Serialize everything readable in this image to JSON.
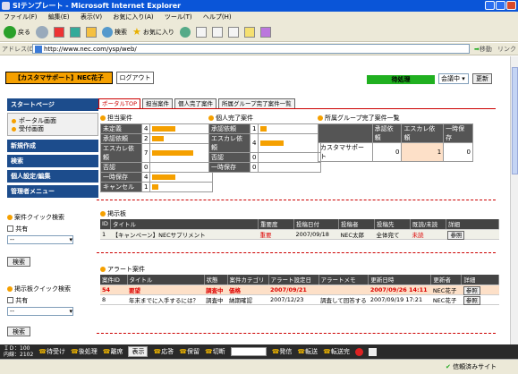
{
  "window": {
    "title": "SIテンプレート - Microsoft Internet Explorer"
  },
  "menu": [
    "ファイル(F)",
    "編集(E)",
    "表示(V)",
    "お気に入り(A)",
    "ツール(T)",
    "ヘルプ(H)"
  ],
  "toolbar": {
    "back": "戻る",
    "search": "検索",
    "favorites": "お気に入り"
  },
  "address": {
    "label": "アドレス(D)",
    "url": "http://www.nec.com/ysp/web/",
    "go": "移動",
    "links": "リンク"
  },
  "header": {
    "logo": "【カスタマサポート】NEC花子",
    "logout": "ログアウト",
    "status": "待処理",
    "meeting": "会議中",
    "update": "更新"
  },
  "sidebar": {
    "start_head": "スタートページ",
    "links": [
      "ポータル画面",
      "受付画面"
    ],
    "menu": [
      "新規作成",
      "検索",
      "個人設定/編集",
      "管理者メニュー"
    ],
    "quick1": {
      "title": "案件クイック検索",
      "checkbox": "共有",
      "select": "--",
      "button": "検索"
    },
    "quick2": {
      "title": "掲示板クイック検索",
      "checkbox": "共有",
      "select": "--",
      "button": "検索"
    }
  },
  "tabs": [
    "ポータルTOP",
    "担当案件",
    "個人完了案件",
    "所属グループ完了案件一覧"
  ],
  "tantou": {
    "title": "担当案件",
    "rows": [
      {
        "label": "未定義",
        "count": "4",
        "ratio": 0.4
      },
      {
        "label": "承認依頼",
        "count": "2",
        "ratio": 0.2
      },
      {
        "label": "エスカレ依頼",
        "count": "7",
        "ratio": 0.7
      },
      {
        "label": "否認",
        "count": "0",
        "ratio": 0
      },
      {
        "label": "一時保存",
        "count": "4",
        "ratio": 0.4
      },
      {
        "label": "キャンセル",
        "count": "1",
        "ratio": 0.1
      }
    ]
  },
  "kojin": {
    "title": "個人完了案件",
    "rows": [
      {
        "label": "承認依頼",
        "count": "1",
        "ratio": 0.1
      },
      {
        "label": "エスカレ依頼",
        "count": "4",
        "ratio": 0.4
      },
      {
        "label": "否認",
        "count": "0",
        "ratio": 0
      },
      {
        "label": "一時保存",
        "count": "0",
        "ratio": 0
      }
    ]
  },
  "group": {
    "title": "所属グループ完了案件一覧",
    "headers": [
      "",
      "承認依頼",
      "エスカレ依頼",
      "一時保存"
    ],
    "row": [
      "カスタマサポート",
      "0",
      "1",
      "0"
    ]
  },
  "bulletin": {
    "title": "掲示板",
    "headers": [
      "ID",
      "タイトル",
      "重要度",
      "投稿日付",
      "投稿者",
      "投稿先",
      "既読/未読",
      "詳細"
    ],
    "rows": [
      [
        "1",
        "【キャンペーン】NECサプリメント",
        "重要",
        "2007/09/18",
        "NEC太郎",
        "全体宛て",
        "未読",
        "参照"
      ]
    ]
  },
  "alert": {
    "title": "アラート案件",
    "headers": [
      "案件ID",
      "タイトル",
      "状態",
      "案件カテゴリ",
      "アラート設定日",
      "アラートメモ",
      "更新日時",
      "更新者",
      "詳細"
    ],
    "rows": [
      [
        "54",
        "要望",
        "調査中",
        "価格",
        "2007/09/21",
        "",
        "2007/09/26 14:11",
        "NEC花子",
        "参照"
      ],
      [
        "8",
        "年末までに入手するには？",
        "調査中",
        "納期確認",
        "2007/12/23",
        "調査して回答する",
        "2007/09/19 17:21",
        "NEC花子",
        "参照"
      ]
    ]
  },
  "phonebar": {
    "id": "ＩＤ：100",
    "inline": "内線：2102",
    "items": [
      "待受け",
      "後処理",
      "離席",
      "表示",
      "応答",
      "保留",
      "切断",
      "発信",
      "転送",
      "転送完"
    ]
  },
  "ie_status": "信頼済みサイト"
}
